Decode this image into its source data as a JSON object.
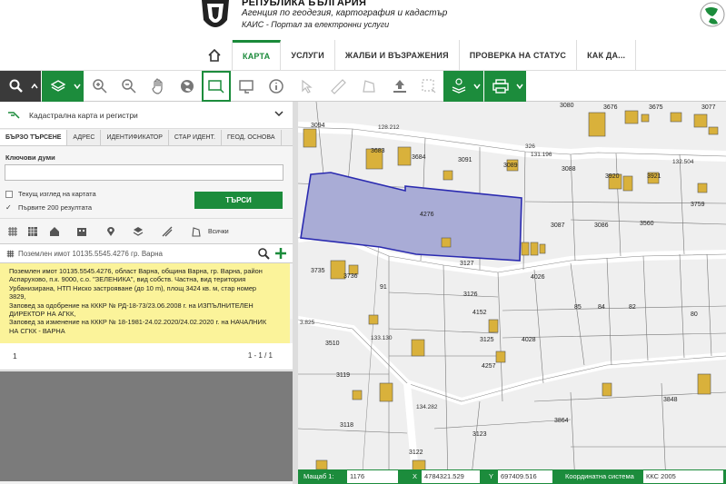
{
  "header": {
    "title": "РЕПУБЛИКА БЪЛГАРИЯ",
    "agency": "Агенция по геодезия, картография и кадастър",
    "portal": "КАИС - Портал за електронни услуги"
  },
  "nav": {
    "items": [
      "КАРТА",
      "УСЛУГИ",
      "ЖАЛБИ И ВЪЗРАЖЕНИЯ",
      "ПРОВЕРКА НА СТАТУС",
      "КАК ДА..."
    ]
  },
  "panel": {
    "layer_title": "Кадастрална карта и регистри",
    "tabs": [
      "БЪРЗО ТЪРСЕНЕ",
      "АДРЕС",
      "ИДЕНТИФИКАТОР",
      "СТАР ИДЕНТ.",
      "ГЕОД. ОСНОВА"
    ],
    "keywords_label": "Ключови думи",
    "keywords_value": "",
    "option_current_view": "Текущ изглед на картата",
    "option_first_200": "Първите 200 резултата",
    "search_button": "ТЪРСИ",
    "filter_all": "Всички",
    "result_title": "Поземлен имот 10135.5545.4276 гр. Варна",
    "result_lines": [
      "Поземлен имот 10135.5545.4276, област Варна, община Варна, гр. Варна, район",
      "Аспарухово, п.к. 9000, с.о. \"ЗЕЛЕНИКА\", вид собств. Частна, вид територия",
      "Урбанизирана, НТП Ниско застрояване (до 10 m), площ 3424 кв. м, стар номер",
      "3829,",
      "Заповед за одобрение на КККР № РД-18-73/23.06.2008 г. на ИЗПЪЛНИТЕЛЕН",
      "ДИРЕКТОР НА АГКК,",
      "Заповед за изменение на КККР № 18-1981-24.02.2020/24.02.2020 г. на НАЧАЛНИК",
      "НА СГКК - ВАРНА"
    ],
    "page": "1",
    "page_count": "1 - 1 / 1"
  },
  "map": {
    "selected_parcel": "4276",
    "labels": [
      "3094",
      "3683",
      "3684",
      "3091",
      "3089",
      "3080",
      "3676",
      "3675",
      "3088",
      "3920",
      "3921",
      "3087",
      "3086",
      "3560",
      "3759",
      "3127",
      "4026",
      "3735",
      "3736",
      "91",
      "3126",
      "4152",
      "4028",
      "85",
      "84",
      "82",
      "80",
      "3510",
      "3125",
      "4257",
      "3119",
      "3118",
      "3123",
      "3864",
      "3848",
      "3122",
      "3077",
      "326",
      "131.196",
      "132.504",
      "128.212",
      "133.130",
      "134.282",
      "3.825"
    ]
  },
  "statusbar": {
    "scale_label": "Мащаб 1:",
    "scale_value": "1176",
    "x_label": "X",
    "x_value": "4784321.529",
    "y_label": "Y",
    "y_value": "697409.516",
    "crs_label": "Координатна система",
    "crs_value": "ККС 2005"
  },
  "colors": {
    "brand_green": "#1c8c3c",
    "toolbar_dark": "#3a3a3a",
    "result_yellow": "#fbf39a",
    "parcel_fill": "#a9acd6",
    "parcel_stroke": "#2a2ab0",
    "building_fill": "#d9b13b"
  }
}
